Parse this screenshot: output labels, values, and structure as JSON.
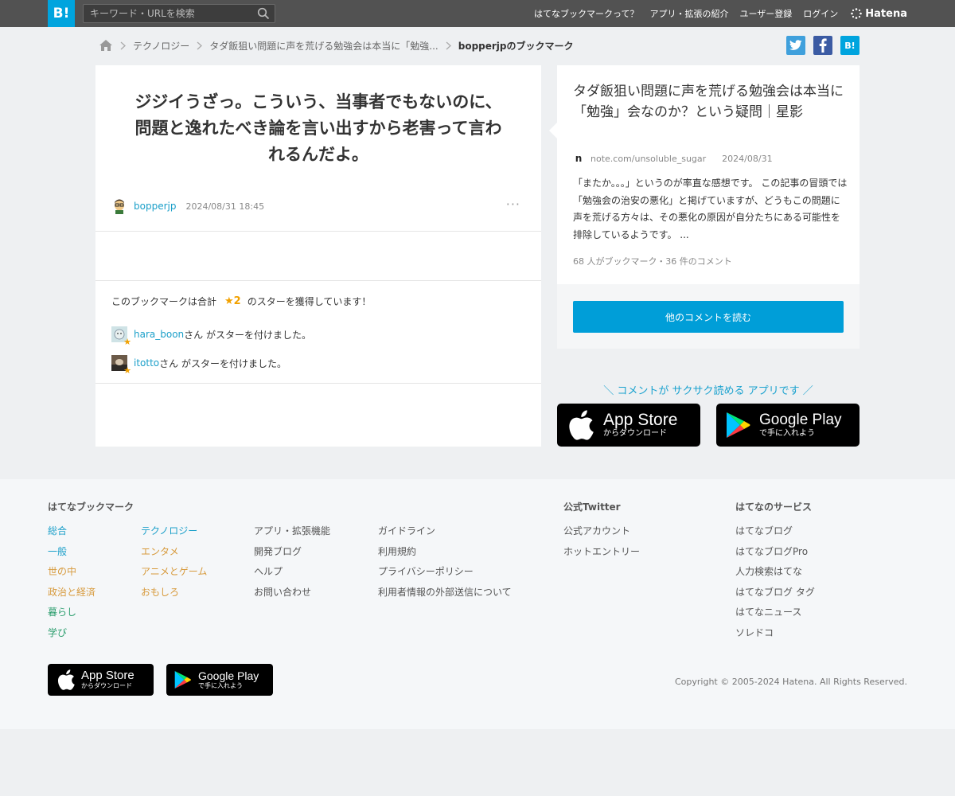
{
  "header": {
    "logo": "B!",
    "search_placeholder": "キーワード・URLを検索",
    "nav": [
      "はてなブックマークって？",
      "アプリ・拡張の紹介",
      "ユーザー登録",
      "ログイン"
    ],
    "brand": "Hatena"
  },
  "breadcrumb": {
    "category": "テクノロジー",
    "entry": "タダ飯狙い問題に声を荒げる勉強会は本当に「勉強...",
    "current": "bopperjpのブックマーク"
  },
  "share": {
    "twitter": "t",
    "facebook": "f",
    "hatena": "B!"
  },
  "bookmark": {
    "comment_lines": [
      "ジジイうざっ。こういう、当事者でもないのに、",
      "問題と逸れたべき論を言い出すから老害って言わ",
      "れるんだよ。"
    ],
    "user": "bopperjp",
    "date": "2024/08/31 18:45",
    "more": "···"
  },
  "stars": {
    "prefix": "このブックマークは合計",
    "count": "★2",
    "suffix": "のスターを獲得しています！",
    "users": [
      {
        "name": "hara_boon",
        "text": "さん がスターを付けました。"
      },
      {
        "name": "itotto",
        "text": "さん がスターを付けました。"
      }
    ],
    "mini_star": "★"
  },
  "entry": {
    "title": "タダ飯狙い問題に声を荒げる勉強会は本当に「勉強」会なのか？という疑問｜星影",
    "favicon": "n",
    "domain": "note.com/unsoluble_sugar",
    "date": "2024/08/31",
    "description": "「またか。。。」というのが率直な感想です。 この記事の冒頭では「勉強会の治安の悪化」と掲げていますが、どうもこの問題に声を荒げる方々は、その悪化の原因が自分たちにある可能性を排除しているようです。 ...",
    "counts": "68 人がブックマーク・36 件のコメント",
    "read_button": "他のコメントを読む"
  },
  "promo": {
    "text": "＼ コメントが サクサク読める アプリです ／"
  },
  "stores": {
    "appstore_big": "App Store",
    "appstore_small": "からダウンロード",
    "googleplay_big": "Google Play",
    "googleplay_small": "で手に入れよう"
  },
  "footer": {
    "bookmark_heading": "はてなブックマーク",
    "col1": [
      "総合",
      "一般",
      "世の中",
      "政治と経済",
      "暮らし",
      "学び"
    ],
    "col2": [
      "テクノロジー",
      "エンタメ",
      "アニメとゲーム",
      "おもしろ"
    ],
    "col3": [
      "アプリ・拡張機能",
      "開発ブログ",
      "ヘルプ",
      "お問い合わせ"
    ],
    "col4": [
      "ガイドライン",
      "利用規約",
      "プライバシーポリシー",
      "利用者情報の外部送信について"
    ],
    "twitter_heading": "公式Twitter",
    "twitter_links": [
      "公式アカウント",
      "ホットエントリー"
    ],
    "services_heading": "はてなのサービス",
    "services_links": [
      "はてなブログ",
      "はてなブログPro",
      "人力検索はてな",
      "はてなブログ タグ",
      "はてなニュース",
      "ソレドコ"
    ],
    "copyright": "Copyright © 2005-2024 Hatena. All Rights Reserved."
  },
  "colors": {
    "header_bg": "#525252",
    "brand_blue": "#00a4de",
    "link_blue": "#1a9fc9",
    "star_orange": "#f2a100",
    "cat_general": "#1a9fc9",
    "cat_world": "#d79a3c",
    "cat_politics": "#d79a3c",
    "cat_life": "#2c9e6e",
    "cat_learn": "#2c9e6e",
    "cat_tech": "#1a9fc9",
    "cat_ent": "#d79a3c"
  }
}
